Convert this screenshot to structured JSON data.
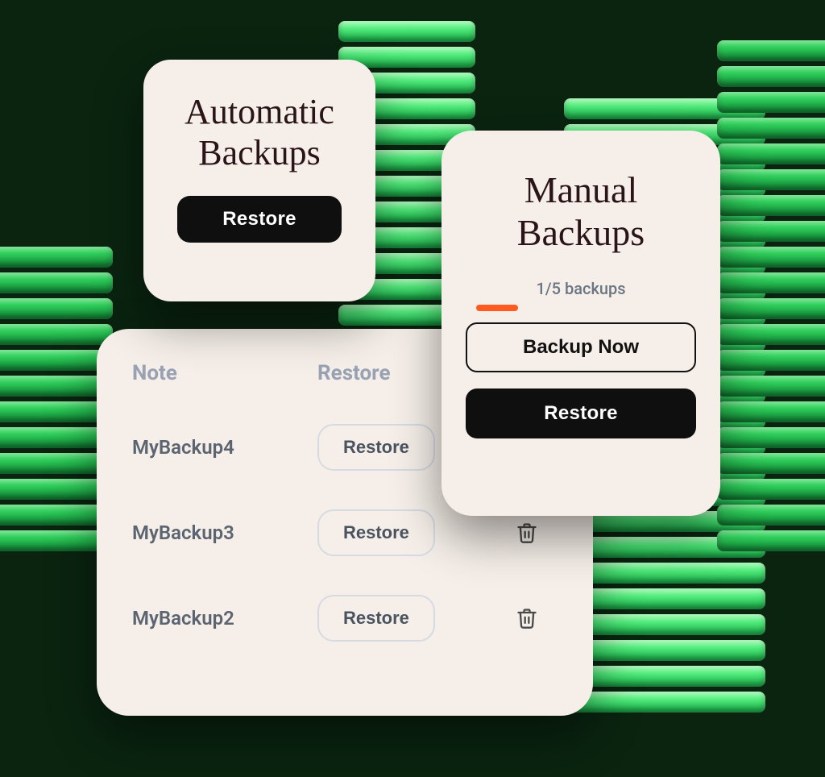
{
  "auto": {
    "title": "Automatic Backups",
    "restore_label": "Restore"
  },
  "manual": {
    "title": "Manual Backups",
    "count_text": "1/5 backups",
    "progress_percent": 20,
    "backup_now_label": "Backup Now",
    "restore_label": "Restore"
  },
  "list": {
    "headers": {
      "note": "Note",
      "restore": "Restore"
    },
    "rows": [
      {
        "note": "MyBackup4",
        "restore_label": "Restore"
      },
      {
        "note": "MyBackup3",
        "restore_label": "Restore"
      },
      {
        "note": "MyBackup2",
        "restore_label": "Restore"
      }
    ]
  },
  "colors": {
    "accent": "#ff5a1f",
    "card_bg": "#f6efe9",
    "bg": "#0a2410"
  }
}
